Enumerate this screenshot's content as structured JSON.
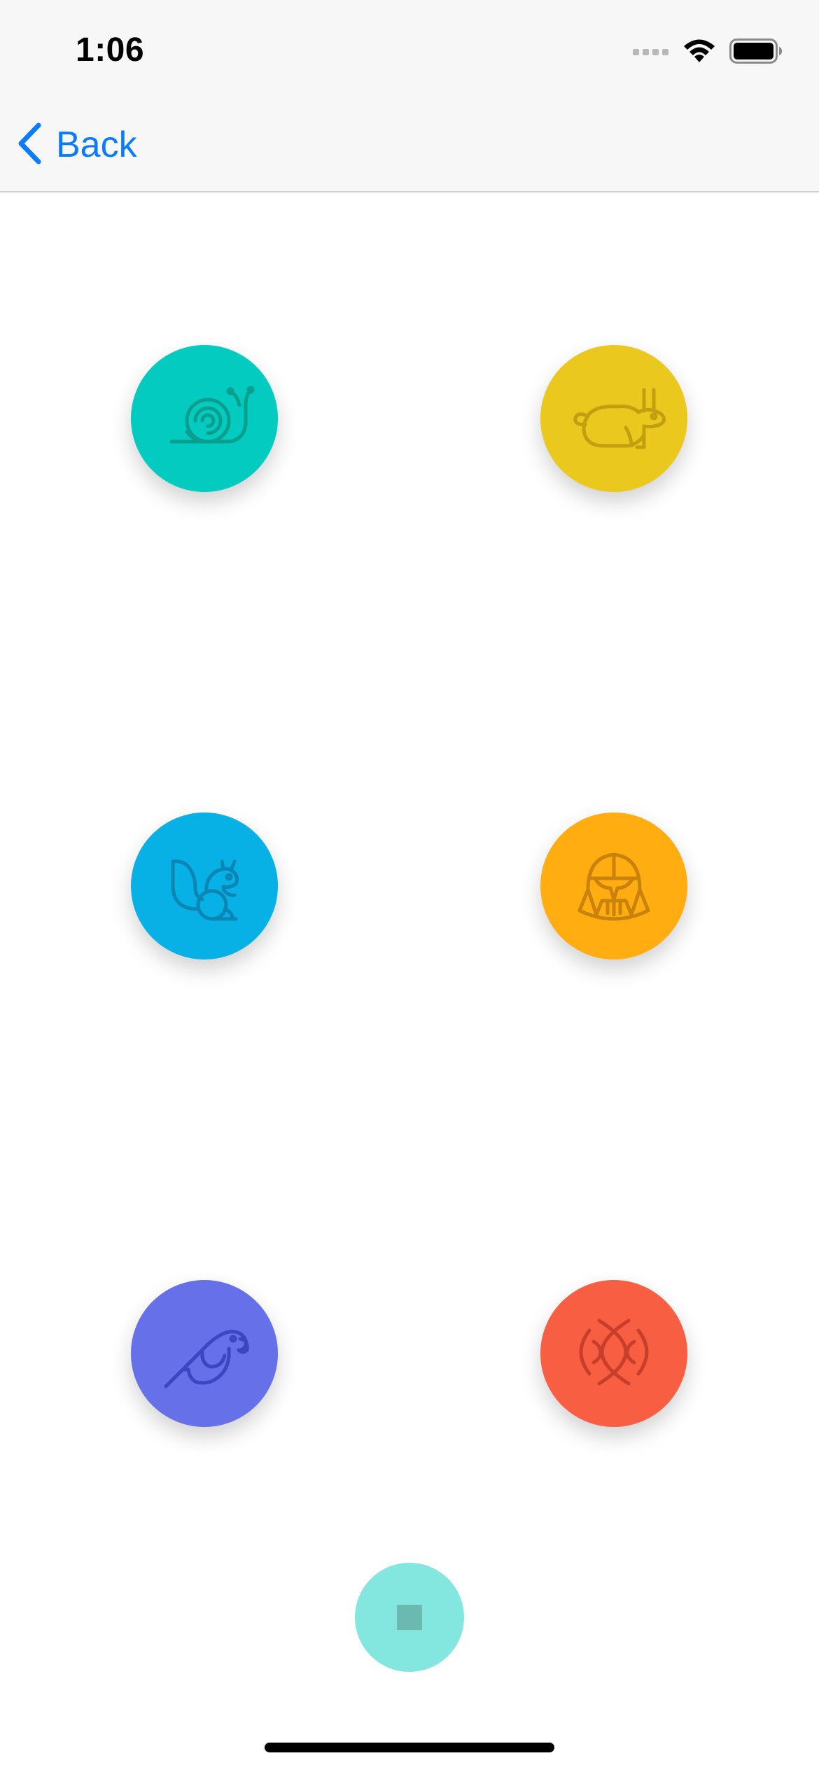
{
  "status_bar": {
    "time": "1:06",
    "icons": [
      "signal-icon",
      "wifi-icon",
      "battery-icon"
    ]
  },
  "nav": {
    "back_label": "Back",
    "back_icon": "chevron-left-icon",
    "accent": "#0a7aff"
  },
  "buttons": [
    {
      "name": "snail-button",
      "icon": "snail-icon",
      "color": "#03cbbf",
      "stroke": "#0a9e8f"
    },
    {
      "name": "rabbit-button",
      "icon": "rabbit-icon",
      "color": "#eac81d",
      "stroke": "#c29f10"
    },
    {
      "name": "squirrel-button",
      "icon": "squirrel-icon",
      "color": "#08b1e5",
      "stroke": "#0a86b4"
    },
    {
      "name": "darth-vader-button",
      "icon": "darth-vader-icon",
      "color": "#ffad11",
      "stroke": "#c9820c"
    },
    {
      "name": "parrot-button",
      "icon": "parrot-icon",
      "color": "#6570e9",
      "stroke": "#3b46c0"
    },
    {
      "name": "sound-waves-button",
      "icon": "sound-waves-icon",
      "color": "#f85e41",
      "stroke": "#c73e2a"
    }
  ],
  "stop_button": {
    "icon": "stop-icon",
    "color": "#83e6df"
  }
}
